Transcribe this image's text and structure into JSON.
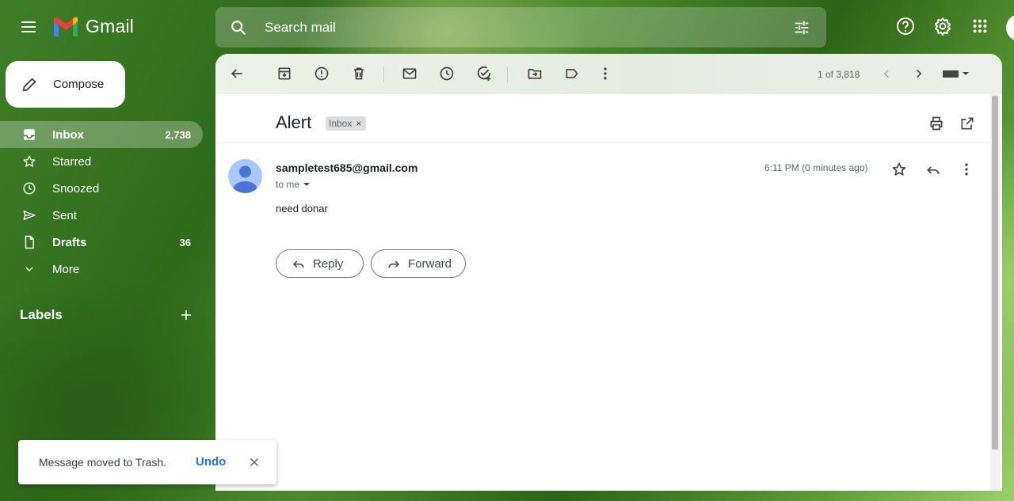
{
  "app": {
    "name": "Gmail"
  },
  "search": {
    "placeholder": "Search mail"
  },
  "sidebar": {
    "compose_label": "Compose",
    "items": [
      {
        "label": "Inbox",
        "count": "2,738"
      },
      {
        "label": "Starred",
        "count": ""
      },
      {
        "label": "Snoozed",
        "count": ""
      },
      {
        "label": "Sent",
        "count": ""
      },
      {
        "label": "Drafts",
        "count": "36"
      },
      {
        "label": "More",
        "count": ""
      }
    ],
    "labels_heading": "Labels"
  },
  "toolbar": {
    "pager": "1 of 3,818"
  },
  "message": {
    "subject": "Alert",
    "label_chip": "Inbox",
    "label_chip_remove": "×",
    "sender": "sampletest685@gmail.com",
    "recipient": "to me",
    "time": "6:11 PM (0 minutes ago)",
    "body": "need donar",
    "reply_label": "Reply",
    "forward_label": "Forward"
  },
  "toast": {
    "message": "Message moved to Trash.",
    "undo_label": "Undo"
  },
  "colors": {
    "accent": "#1a73e8",
    "active_nav": "#ffffff47",
    "avatar": "#a8c7fa"
  }
}
